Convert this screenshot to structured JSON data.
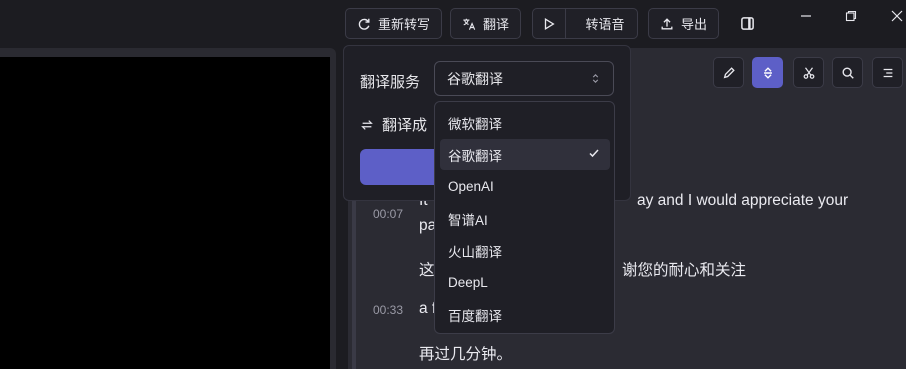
{
  "toolbar": {
    "retranscribe": "重新转写",
    "translate": "翻译",
    "to_speech": "转语音",
    "export": "导出"
  },
  "transcript": {
    "items": [
      {
        "time": "00:07",
        "line1": "It",
        "line1b": "ay and I would appreciate your",
        "line2": "pa",
        "zh1": "这",
        "zh1b": "谢您的耐心和关注"
      },
      {
        "time": "00:33",
        "line1": "a f",
        "zh1": "再过几分钟。"
      }
    ]
  },
  "translate_panel": {
    "service_label": "翻译服务",
    "selected": "谷歌翻译",
    "translate_to_label": "翻译成",
    "options": [
      "微软翻译",
      "谷歌翻译",
      "OpenAI",
      "智谱AI",
      "火山翻译",
      "DeepL",
      "百度翻译"
    ]
  },
  "colors": {
    "accent": "#5d5fc7",
    "background": "#1c1c21",
    "panel": "#2b2b33"
  }
}
